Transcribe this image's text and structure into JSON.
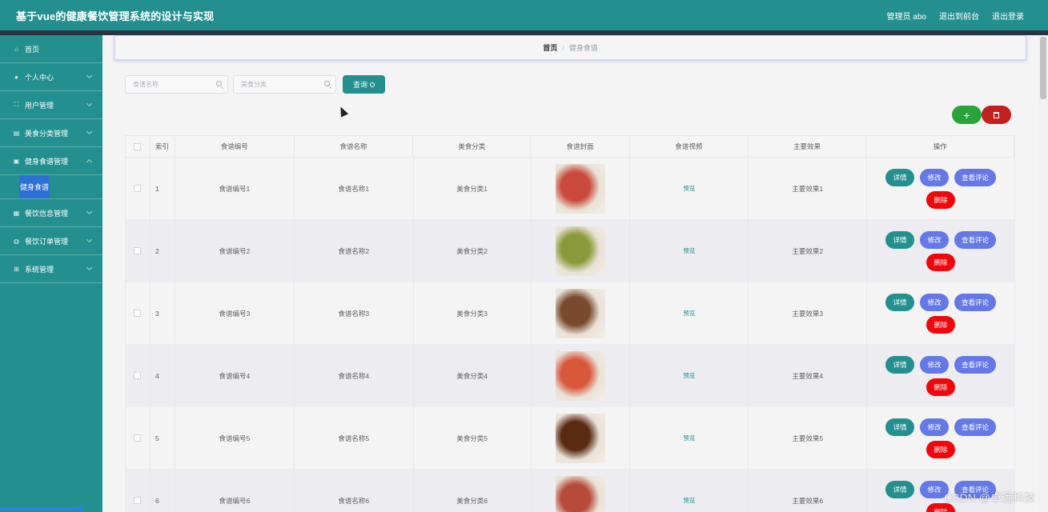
{
  "header": {
    "title": "基于vue的健康餐饮管理系统的设计与实现",
    "user": "管理员 abo",
    "to_front": "退出到前台",
    "logout": "退出登录"
  },
  "sidebar": {
    "items": [
      {
        "label": "首页",
        "icon": "home-icon"
      },
      {
        "label": "个人中心",
        "icon": "user-icon"
      },
      {
        "label": "用户管理",
        "icon": "users-icon"
      },
      {
        "label": "美食分类管理",
        "icon": "category-icon"
      },
      {
        "label": "健身食谱管理",
        "icon": "recipe-icon"
      },
      {
        "label": "餐饮信息管理",
        "icon": "info-icon"
      },
      {
        "label": "餐饮订单管理",
        "icon": "order-icon"
      },
      {
        "label": "系统管理",
        "icon": "system-icon"
      }
    ],
    "sub_active": "健身食谱"
  },
  "breadcrumb": {
    "home": "首页",
    "separator": "/",
    "current": "健身食谱"
  },
  "search": {
    "name_placeholder": "食谱名称",
    "category_placeholder": "美食分类",
    "query_label": "查询"
  },
  "actions": {
    "add": "+"
  },
  "table": {
    "columns": [
      "索引",
      "食谱编号",
      "食谱名称",
      "美食分类",
      "食谱封面",
      "食谱视频",
      "主要效果",
      "操作"
    ],
    "buttons": {
      "detail": "详情",
      "edit": "修改",
      "comment": "查看评论",
      "delete": "删除"
    },
    "rows": [
      {
        "index": "1",
        "no": "食谱编号1",
        "name": "食谱名称1",
        "category": "美食分类1",
        "video": "预览",
        "effect": "主要效果1",
        "cover_color": "#c94a3a"
      },
      {
        "index": "2",
        "no": "食谱编号2",
        "name": "食谱名称2",
        "category": "美食分类2",
        "video": "预览",
        "effect": "主要效果2",
        "cover_color": "#8a9a3a"
      },
      {
        "index": "3",
        "no": "食谱编号3",
        "name": "食谱名称3",
        "category": "美食分类3",
        "video": "预览",
        "effect": "主要效果3",
        "cover_color": "#7a4a2e"
      },
      {
        "index": "4",
        "no": "食谱编号4",
        "name": "食谱名称4",
        "category": "美食分类4",
        "video": "预览",
        "effect": "主要效果4",
        "cover_color": "#d8583a"
      },
      {
        "index": "5",
        "no": "食谱编号5",
        "name": "食谱名称5",
        "category": "美食分类5",
        "video": "预览",
        "effect": "主要效果5",
        "cover_color": "#5a2a12"
      },
      {
        "index": "6",
        "no": "食谱编号6",
        "name": "食谱名称6",
        "category": "美食分类6",
        "video": "预览",
        "effect": "主要效果6",
        "cover_color": "#b84a3a"
      }
    ]
  },
  "watermark": "CSDN @卓远科技"
}
